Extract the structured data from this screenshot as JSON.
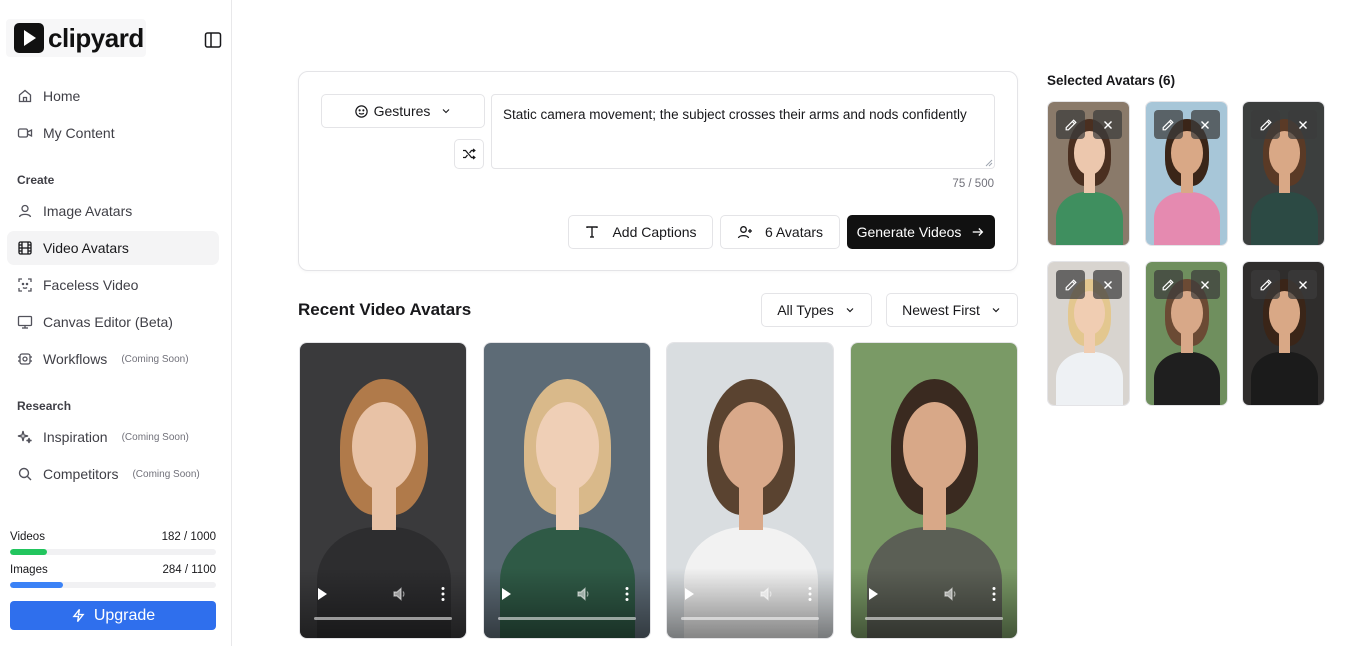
{
  "app": {
    "logo_text": "clipyard"
  },
  "sidebar": {
    "items": [
      {
        "label": "Home",
        "icon": "home-icon"
      },
      {
        "label": "My Content",
        "icon": "video-camera-icon"
      }
    ],
    "create_label": "Create",
    "create_items": [
      {
        "label": "Image Avatars",
        "icon": "user-icon"
      },
      {
        "label": "Video Avatars",
        "icon": "film-icon",
        "active": true
      },
      {
        "label": "Faceless Video",
        "icon": "face-scan-icon"
      },
      {
        "label": "Canvas Editor (Beta)",
        "icon": "monitor-icon"
      },
      {
        "label": "Workflows",
        "icon": "workflow-icon",
        "badge": "(Coming Soon)"
      }
    ],
    "research_label": "Research",
    "research_items": [
      {
        "label": "Inspiration",
        "icon": "sparkles-icon",
        "badge": "(Coming Soon)"
      },
      {
        "label": "Competitors",
        "icon": "search-icon",
        "badge": "(Coming Soon)"
      }
    ],
    "usage": {
      "videos_label": "Videos",
      "videos_value": "182 / 1000",
      "videos_fraction": 0.182,
      "videos_color": "#22c55e",
      "images_label": "Images",
      "images_value": "284 / 1100",
      "images_fraction": 0.258,
      "images_color": "#3b82f6"
    },
    "upgrade_label": "Upgrade"
  },
  "prompt": {
    "gestures_label": "Gestures",
    "text": "Static camera movement; the subject crosses their arms and nods confidently",
    "char_count": "75 / 500",
    "captions_label": "Add Captions",
    "avatars_label": "6 Avatars",
    "generate_label": "Generate Videos"
  },
  "recent": {
    "title": "Recent Video Avatars",
    "type_filter": "All Types",
    "sort_filter": "Newest First",
    "videos": [
      {
        "bg": "#3a3a3c",
        "skin": "#e8c2a6",
        "hair": "#b07a4a",
        "shirt": "#2d2d2f"
      },
      {
        "bg": "#5d6b76",
        "skin": "#efcfb6",
        "hair": "#d9b98a",
        "shirt": "#2f5a46"
      },
      {
        "bg": "#d9dde0",
        "skin": "#d9a98a",
        "hair": "#5a4330",
        "shirt": "#f2f2f2"
      },
      {
        "bg": "#7a9a66",
        "skin": "#d8a888",
        "hair": "#3a2a20",
        "shirt": "#5b5f55"
      }
    ]
  },
  "selected": {
    "title": "Selected Avatars (6)",
    "avatars": [
      {
        "bg": "#8a7a6a",
        "skin": "#ecc7ad",
        "hair": "#4a2f20",
        "shirt": "#3f8f5f"
      },
      {
        "bg": "#a7c6d8",
        "skin": "#d9a886",
        "hair": "#3a2518",
        "shirt": "#e58ab0"
      },
      {
        "bg": "#3c3f3e",
        "skin": "#d9a886",
        "hair": "#5a3a26",
        "shirt": "#2c4a44"
      },
      {
        "bg": "#d8d4cf",
        "skin": "#f0cdb2",
        "hair": "#e3c78f",
        "shirt": "#eef1f4"
      },
      {
        "bg": "#6f8f5e",
        "skin": "#d8a888",
        "hair": "#6b4a34",
        "shirt": "#1f1f1f"
      },
      {
        "bg": "#2f2d2c",
        "skin": "#d9a886",
        "hair": "#3a2518",
        "shirt": "#1b1b1b"
      }
    ]
  }
}
